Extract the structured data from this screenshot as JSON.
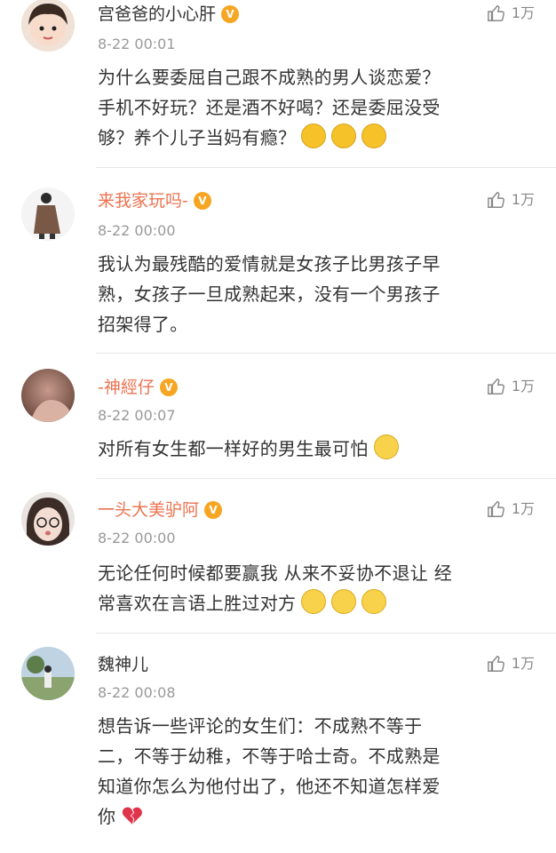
{
  "comments": [
    {
      "name": "宫爸爸的小心肝",
      "time": "8-22 00:01",
      "likes": "1万",
      "lines": [
        "为什么要委屈自己跟不成熟的男人谈恋爱？",
        "手机不好玩？还是酒不好喝？还是委屈没受",
        "够？养个儿子当妈有瘾？"
      ],
      "emoji_icons": [
        "angry-emoji-icon",
        "angry-emoji-icon",
        "angry-emoji-icon"
      ]
    },
    {
      "name": "来我家玩吗-",
      "time": "8-22 00:00",
      "likes": "1万",
      "lines": [
        "我认为最残酷的爱情就是女孩子比男孩子早",
        "熟，女孩子一旦成熟起来，没有一个男孩子",
        "招架得了。"
      ]
    },
    {
      "name": "-神經仔",
      "time": "8-22 00:07",
      "likes": "1万",
      "lines": [
        "对所有女生都一样好的男生最可怕"
      ],
      "emoji_icons": [
        "thinking-emoji-icon"
      ]
    },
    {
      "name": "一头大美驴阿",
      "time": "8-22 00:00",
      "likes": "1万",
      "lines": [
        "无论任何时候都要赢我 从来不妥协不退让 经",
        "常喜欢在言语上胜过对方"
      ],
      "emoji_icons": [
        "thinking-emoji-icon",
        "thinking-emoji-icon",
        "thinking-emoji-icon"
      ]
    },
    {
      "name": "魏神儿",
      "time": "8-22 00:08",
      "likes": "1万",
      "lines": [
        "想告诉一些评论的女生们：不成熟不等于",
        "二，不等于幼稚，不等于哈士奇。不成熟是",
        "知道你怎么为他付出了，他还不知道怎样爱",
        "你"
      ],
      "emoji_icons": [
        "broken-heart-icon"
      ]
    }
  ],
  "colors": {
    "vip_name": "#eb7350",
    "time": "#999999",
    "divider": "#e6e6e6"
  },
  "icons": {
    "like": "thumbs-up-icon",
    "vip": "vip-badge-icon"
  }
}
